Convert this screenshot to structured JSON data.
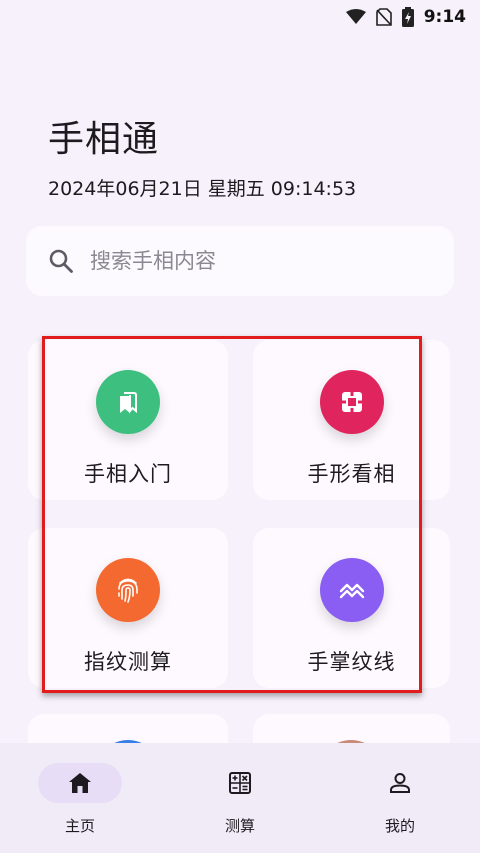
{
  "status_bar": {
    "time": "9:14"
  },
  "header": {
    "title": "手相通",
    "datetime": "2024年06月21日 星期五  09:14:53"
  },
  "search": {
    "placeholder": "搜索手相内容"
  },
  "categories": [
    {
      "label": "手相入门",
      "icon": "bookmark-icon",
      "color": "#3dbf7f"
    },
    {
      "label": "手形看相",
      "icon": "palm-frame-icon",
      "color": "#e0245e"
    },
    {
      "label": "指纹测算",
      "icon": "fingerprint-icon",
      "color": "#f4692f"
    },
    {
      "label": "手掌纹线",
      "icon": "lines-icon",
      "color": "#8a5ef2"
    }
  ],
  "peek_colors": [
    "#3a7ee8",
    "#c98a78"
  ],
  "nav": [
    {
      "label": "主页",
      "icon": "home-icon",
      "active": true
    },
    {
      "label": "测算",
      "icon": "calculator-icon",
      "active": false
    },
    {
      "label": "我的",
      "icon": "person-icon",
      "active": false
    }
  ]
}
